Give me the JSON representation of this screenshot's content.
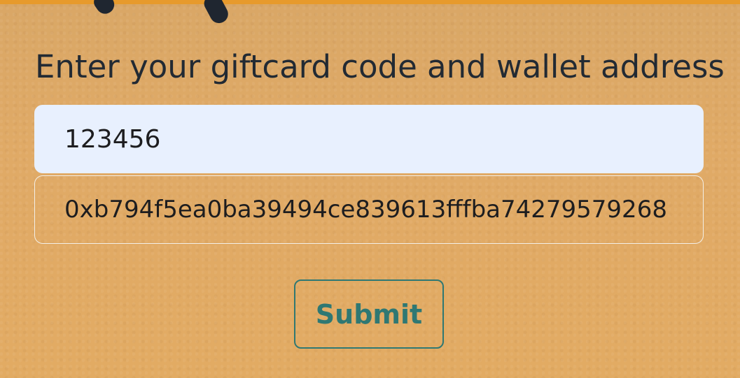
{
  "form": {
    "title": "Enter your giftcard code and wallet address",
    "giftcard_code": "123456",
    "wallet_address": "0xb794f5ea0ba39494ce839613fffba74279579268",
    "submit_label": "Submit"
  },
  "colors": {
    "background": "#e0aa66",
    "accent": "#2f7873",
    "input_fill": "#e8f0fe"
  }
}
